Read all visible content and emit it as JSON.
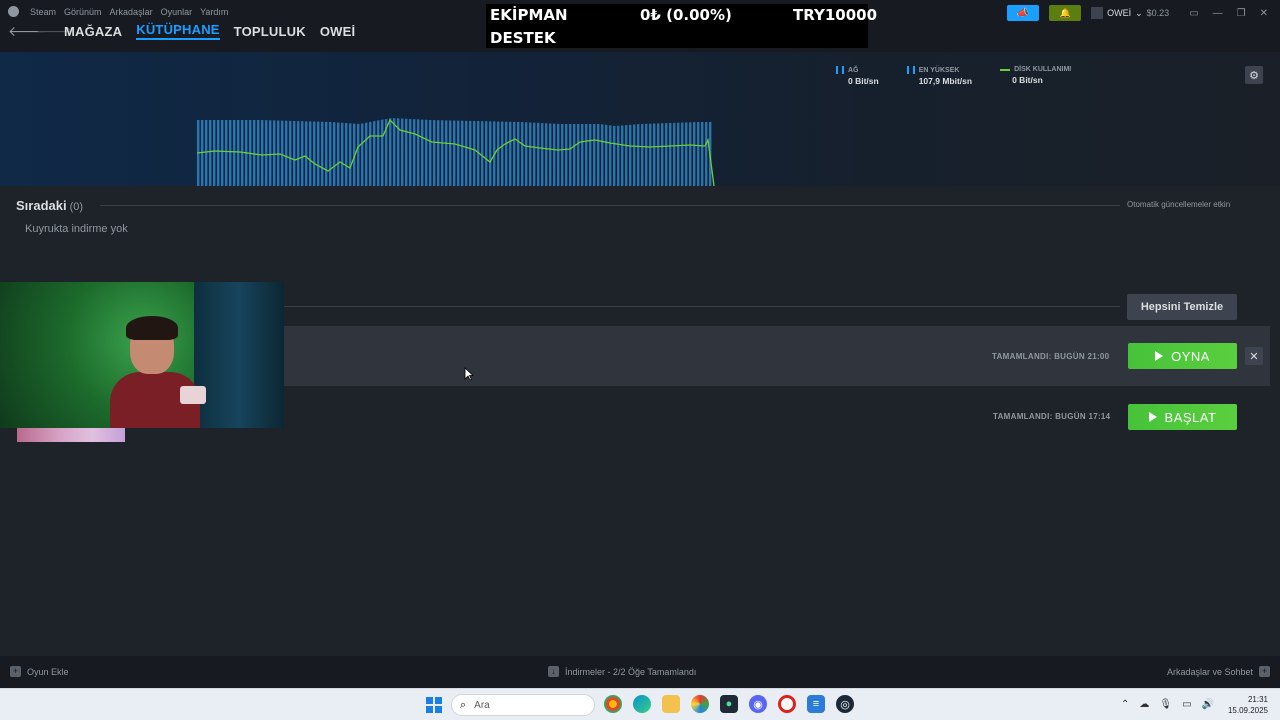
{
  "menu": [
    "Steam",
    "Görünüm",
    "Arkadaşlar",
    "Oyunlar",
    "Yardım"
  ],
  "nav": {
    "tabs": [
      "MAĞAZA",
      "KÜTÜPHANE",
      "TOPLULUK",
      "OWEİ"
    ],
    "active_tab": "KÜTÜPHANE"
  },
  "stream_overlay": {
    "line1_left": "EKİPMAN",
    "line1_mid": "0₺ (0.00%)",
    "line1_right": "TRY10000",
    "line2_left": "DESTEK"
  },
  "account": {
    "name": "OWEİ",
    "balance": "$0.23"
  },
  "stats": {
    "network": {
      "label": "AĞ",
      "value": "0 Bit/sn"
    },
    "peak": {
      "label": "EN YÜKSEK",
      "value": "107,9 Mbit/sn"
    },
    "disk": {
      "label": "DİSK KULLANIMI",
      "value": "0 Bit/sn"
    }
  },
  "queue": {
    "title": "Sıradaki",
    "count": "(0)",
    "auto_updates": "Otomatik güncellemeler etkin",
    "empty_text": "Kuyrukta indirme yok"
  },
  "completed": {
    "clear_all_label": "Hepsini Temizle",
    "items": [
      {
        "status": "TAMAMLANDI: BUGÜN 21:00",
        "action": "OYNA",
        "close": "✕"
      },
      {
        "status": "TAMAMLANDI: BUGÜN 17:14",
        "action": "BAŞLAT"
      }
    ]
  },
  "bottombar": {
    "add_game": "Oyun Ekle",
    "downloads": "İndirmeler - 2/2 Öğe Tamamlandı",
    "friends": "Arkadaşlar ve Sohbet"
  },
  "taskbar": {
    "search_placeholder": "Ara",
    "time": "21:31",
    "date": "15.09.2025"
  },
  "colors": {
    "accent": "#1a9fff",
    "play_green": "#5acf3e",
    "bg": "#1e2229",
    "graph_line": "#6bcf3a"
  }
}
